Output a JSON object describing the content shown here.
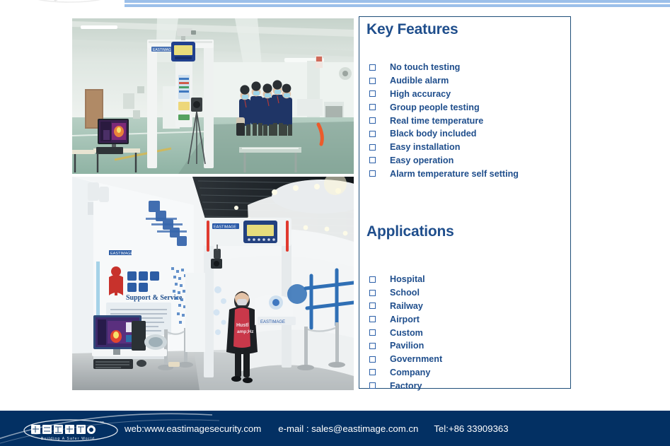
{
  "header": {
    "logo_alt": "eastimage-watermark"
  },
  "photos": [
    {
      "name": "photo-walkthrough-detector-factory",
      "caption": "Walk-through metal detector with thermal temperature screening in a factory hall, workers in masks queueing"
    },
    {
      "name": "photo-walkthrough-detector-showroom",
      "caption": "Woman in mask walking through EASTIMAGE walk-through detector in a showroom with thermal monitor"
    }
  ],
  "panel": {
    "key_features": {
      "heading": "Key Features",
      "items": [
        "No touch testing",
        "Audible alarm",
        "High accuracy",
        "Group people testing",
        "Real time temperature",
        "Black body included",
        "Easy installation",
        "Easy operation",
        "Alarm temperature self setting"
      ]
    },
    "applications": {
      "heading": "Applications",
      "items": [
        "Hospital",
        "School",
        "Railway",
        "Airport",
        "Custom",
        "Pavilion",
        "Government",
        "Company",
        "Factory"
      ]
    }
  },
  "footer": {
    "logo_chinese": "让世界更安全",
    "logo_tagline": "Building A Safer World",
    "logo_tm": "™",
    "web": "web:www.eastimagesecurity.com",
    "email": "e-mail : sales@eastimage.com.cn",
    "tel": "Tel:+86 33909363"
  },
  "colors": {
    "navy": "#033063",
    "heading_blue": "#1F4E8C",
    "border_blue": "#1F4E79",
    "header_band": "#9CC0EA",
    "checkbox_blue": "#2B5FA8"
  }
}
